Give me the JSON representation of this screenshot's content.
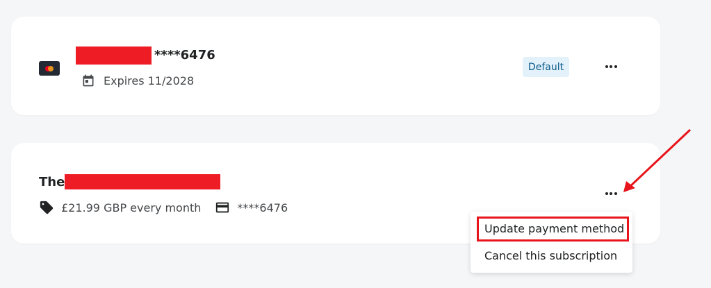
{
  "payment_card": {
    "masked_number": "****6476",
    "expires": "Expires 11/2028",
    "badge": "Default",
    "brand_icon": "mastercard-icon",
    "calendar_icon": "calendar-icon",
    "more_icon": "more-horizontal-icon"
  },
  "subscription": {
    "title_prefix": "The",
    "price": "£21.99 GBP every month",
    "card": "****6476",
    "price_icon": "tag-icon",
    "card_icon": "credit-card-icon",
    "more_icon": "more-horizontal-icon"
  },
  "menu": {
    "items": [
      "Update payment method",
      "Cancel this subscription"
    ]
  },
  "colors": {
    "background": "#f5f6f8",
    "card": "#ffffff",
    "badge_bg": "#e3f1fa",
    "badge_text": "#0b5a8a",
    "redaction": "#ee1c24",
    "annotation": "#e8141b"
  }
}
